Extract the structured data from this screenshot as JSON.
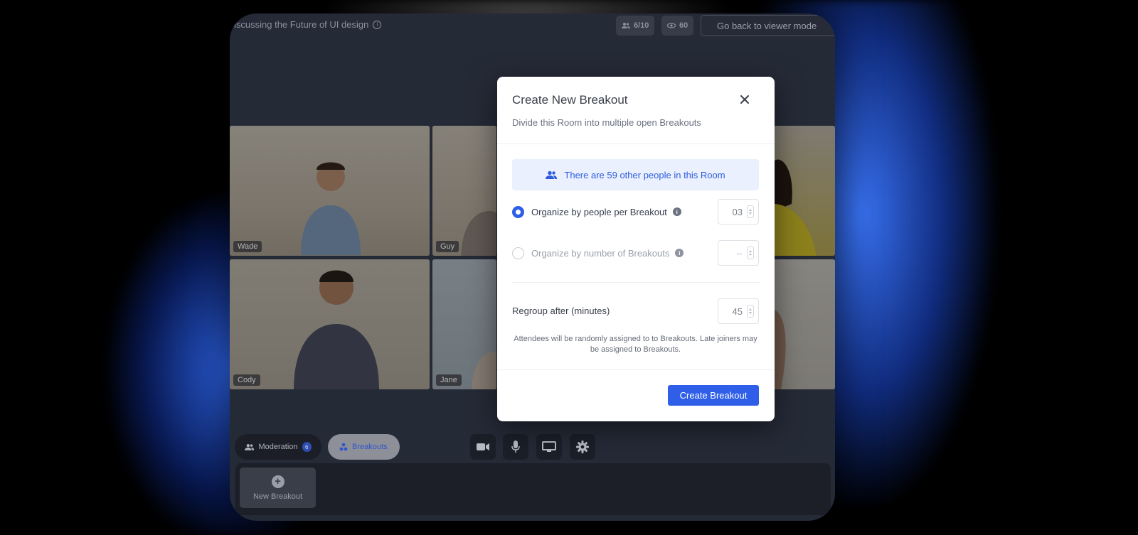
{
  "colors": {
    "accent": "#2f5fe9",
    "app_background": "#252a37",
    "modal_background": "#ffffff",
    "banner_background": "#eaf0fd",
    "banner_text": "#2e5ce0"
  },
  "topbar": {
    "room_title": "iscussing the Future of UI design",
    "participants_count": "6/10",
    "viewers_count": "60",
    "viewer_mode_button": "Go back to viewer mode"
  },
  "video_grid": [
    {
      "name": "Wade"
    },
    {
      "name": "Guy"
    },
    {
      "name": "Cody"
    },
    {
      "name": "Jane"
    }
  ],
  "bottom_bar": {
    "moderation_label": "Moderation",
    "moderation_badge": "6",
    "breakouts_label": "Breakouts",
    "media_buttons": [
      "camera-icon",
      "microphone-icon",
      "screen-share-icon",
      "settings-icon"
    ],
    "new_breakout_label": "New Breakout"
  },
  "modal": {
    "title": "Create New Breakout",
    "subtitle": "Divide this Room into multiple open Breakouts",
    "people_banner": "There are 59 other people in this Room",
    "options": [
      {
        "label": "Organize by people per Breakout",
        "selected": true,
        "value": "03",
        "placeholder": "--"
      },
      {
        "label": "Organize by number of Breakouts",
        "selected": false,
        "value": "",
        "placeholder": "--"
      }
    ],
    "regroup_label": "Regroup after (minutes)",
    "regroup_value": "45",
    "note": "Attendees will be randomly assigned to to Breakouts. Late joiners may be assigned to Breakouts.",
    "create_button": "Create Breakout"
  }
}
